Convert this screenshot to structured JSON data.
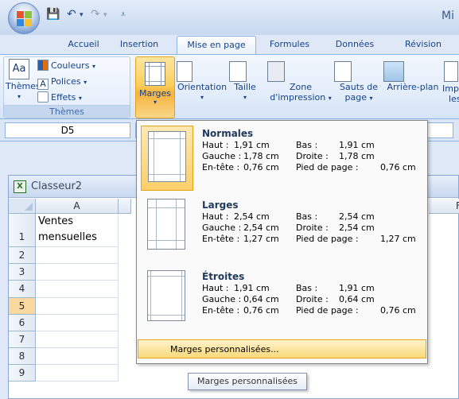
{
  "app": {
    "title": "Mi"
  },
  "tabs": [
    "Accueil",
    "Insertion",
    "Mise en page",
    "Formules",
    "Données",
    "Révision"
  ],
  "ribbon": {
    "themes_group": {
      "themes_label": "Thèmes",
      "colors_label": "Couleurs",
      "fonts_label": "Polices",
      "effects_label": "Effets",
      "group_name": "Thèmes"
    },
    "buttons": {
      "marges": "Marges",
      "orientation": "Orientation",
      "taille": "Taille",
      "zone_line1": "Zone",
      "zone_line2": "d'impression",
      "sauts_line1": "Sauts de",
      "sauts_line2": "page",
      "arriere_plan": "Arrière-plan",
      "imp_line1": "Imp",
      "imp_line2": "les"
    }
  },
  "formula_bar": {
    "cell_ref": "D5"
  },
  "workbook": {
    "name": "Classeur2",
    "columns": [
      "A",
      "F"
    ],
    "rows": [
      "1",
      "2",
      "3",
      "4",
      "5",
      "6",
      "7",
      "8",
      "9"
    ],
    "cells": {
      "A1_line1": "Ventes",
      "A1_line2": "mensuelles"
    }
  },
  "margins_menu": {
    "options": [
      {
        "name": "Normales",
        "haut_label": "Haut :",
        "haut_value": "1,91 cm",
        "bas_label": "Bas :",
        "bas_value": "1,91 cm",
        "gauche_label": "Gauche :",
        "gauche_value": "1,78 cm",
        "droite_label": "Droite :",
        "droite_value": "1,78 cm",
        "entete_label": "En-tête :",
        "entete_value": "0,76 cm",
        "pied_label": "Pied de page :",
        "pied_value": "0,76 cm"
      },
      {
        "name": "Larges",
        "haut_label": "Haut :",
        "haut_value": "2,54 cm",
        "bas_label": "Bas :",
        "bas_value": "2,54 cm",
        "gauche_label": "Gauche :",
        "gauche_value": "2,54 cm",
        "droite_label": "Droite :",
        "droite_value": "2,54 cm",
        "entete_label": "En-tête :",
        "entete_value": "1,27 cm",
        "pied_label": "Pied de page :",
        "pied_value": "1,27 cm"
      },
      {
        "name": "Étroites",
        "haut_label": "Haut :",
        "haut_value": "1,91 cm",
        "bas_label": "Bas :",
        "bas_value": "1,91 cm",
        "gauche_label": "Gauche :",
        "gauche_value": "0,64 cm",
        "droite_label": "Droite :",
        "droite_value": "0,64 cm",
        "entete_label": "En-tête :",
        "entete_value": "0,76 cm",
        "pied_label": "Pied de page :",
        "pied_value": "0,76 cm"
      }
    ],
    "custom_label": "Marges personnalisées...",
    "tooltip": "Marges personnalisées"
  }
}
